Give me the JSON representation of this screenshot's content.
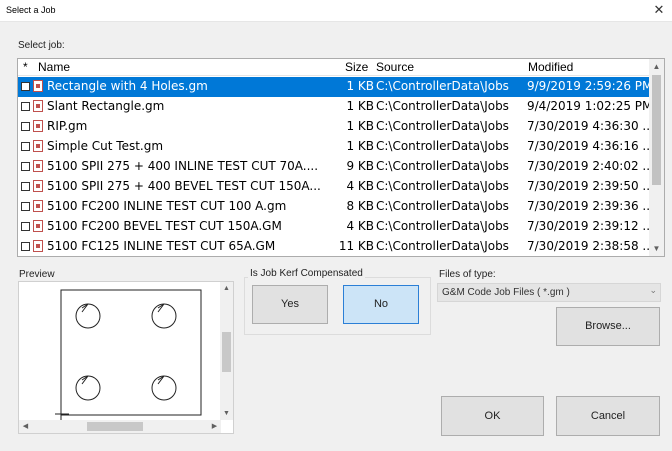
{
  "window": {
    "title": "Select a Job",
    "close_glyph": "✕"
  },
  "labels": {
    "select_job": "Select job:",
    "preview": "Preview",
    "kerf": "Is Job Kerf Compensated",
    "files_of_type": "Files of type:"
  },
  "table": {
    "columns": {
      "star": "*",
      "name": "Name",
      "size": "Size",
      "source": "Source",
      "modified": "Modified"
    },
    "rows": [
      {
        "name": "Rectangle with 4 Holes.gm",
        "size": "1 KB",
        "source": "C:\\ControllerData\\Jobs",
        "modified": "9/9/2019 2:59:26 PM",
        "selected": true
      },
      {
        "name": "Slant Rectangle.gm",
        "size": "1 KB",
        "source": "C:\\ControllerData\\Jobs",
        "modified": "9/4/2019 1:02:25 PM"
      },
      {
        "name": "RIP.gm",
        "size": "1 KB",
        "source": "C:\\ControllerData\\Jobs",
        "modified": "7/30/2019 4:36:30 ..."
      },
      {
        "name": "Simple Cut Test.gm",
        "size": "1 KB",
        "source": "C:\\ControllerData\\Jobs",
        "modified": "7/30/2019 4:36:16 ..."
      },
      {
        "name": "5100 SPII 275 + 400 INLINE TEST CUT 70A....",
        "size": "9 KB",
        "source": "C:\\ControllerData\\Jobs",
        "modified": "7/30/2019 2:40:02 ..."
      },
      {
        "name": "5100 SPII 275 + 400 BEVEL TEST CUT 150A...",
        "size": "4 KB",
        "source": "C:\\ControllerData\\Jobs",
        "modified": "7/30/2019 2:39:50 ..."
      },
      {
        "name": "5100 FC200 INLINE TEST CUT 100 A.gm",
        "size": "8 KB",
        "source": "C:\\ControllerData\\Jobs",
        "modified": "7/30/2019 2:39:36 ..."
      },
      {
        "name": "5100 FC200 BEVEL TEST CUT 150A.GM",
        "size": "4 KB",
        "source": "C:\\ControllerData\\Jobs",
        "modified": "7/30/2019 2:39:12 ..."
      },
      {
        "name": "5100 FC125 INLINE TEST CUT 65A.GM",
        "size": "11 KB",
        "source": "C:\\ControllerData\\Jobs",
        "modified": "7/30/2019 2:38:58 ..."
      }
    ]
  },
  "kerf_buttons": {
    "yes": "Yes",
    "no": "No",
    "selected": "no"
  },
  "file_type": {
    "value": "G&M Code Job Files ( *.gm )"
  },
  "buttons": {
    "browse": "Browse...",
    "ok": "OK",
    "cancel": "Cancel"
  },
  "colors": {
    "selection": "#0078d7",
    "active_button": "#cce4f7",
    "active_border": "#2b7fd6"
  },
  "icons": {
    "file": "gm-file-icon",
    "checkbox": "checkbox-icon"
  }
}
